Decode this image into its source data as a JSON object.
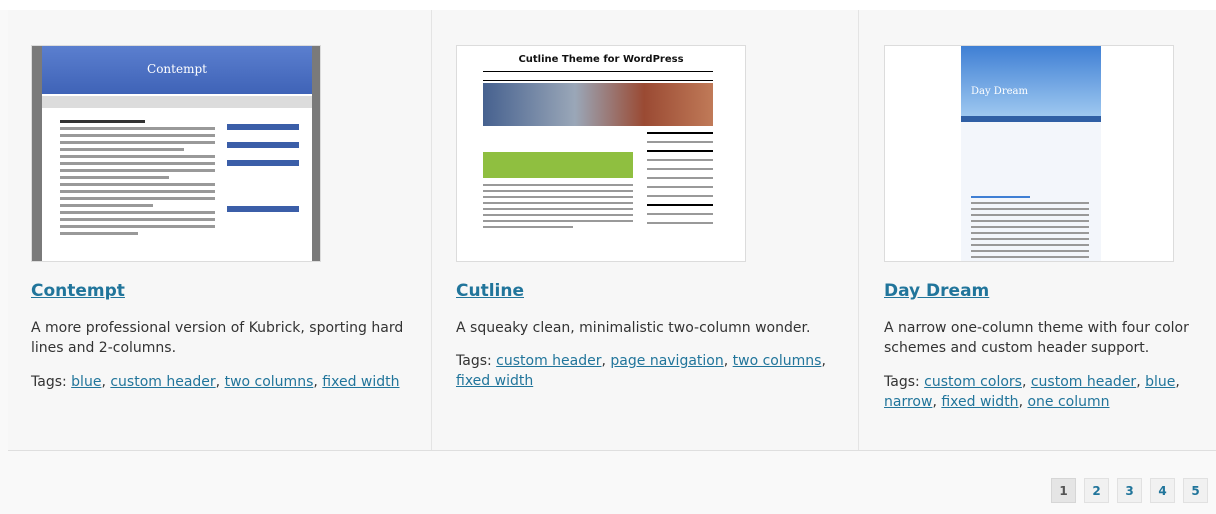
{
  "themes": [
    {
      "thumb_title": "Contempt",
      "name": "Contempt",
      "description": "A more professional version of Kubrick, sporting hard lines and 2-columns.",
      "tags_label": "Tags:",
      "tags": [
        "blue",
        "custom header",
        "two columns",
        "fixed width"
      ]
    },
    {
      "thumb_title": "Cutline Theme for WordPress",
      "name": "Cutline",
      "description": "A squeaky clean, minimalistic two-column wonder.",
      "tags_label": "Tags:",
      "tags": [
        "custom header",
        "page navigation",
        "two columns",
        "fixed width"
      ]
    },
    {
      "thumb_title": "Day Dream",
      "name": "Day Dream",
      "description": "A narrow one-column theme with four color schemes and custom header support.",
      "tags_label": "Tags:",
      "tags": [
        "custom colors",
        "custom header",
        "blue",
        "narrow",
        "fixed width",
        "one column"
      ]
    }
  ],
  "pagination": {
    "pages": [
      "1",
      "2",
      "3",
      "4",
      "5"
    ],
    "current": "1"
  },
  "colors": {
    "link": "#21759b",
    "text": "#333333"
  }
}
